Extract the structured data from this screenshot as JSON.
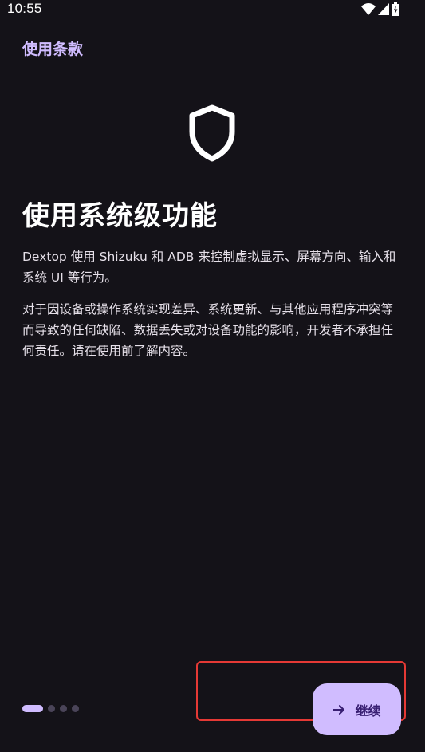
{
  "status_bar": {
    "time": "10:55",
    "icons": [
      "wifi-icon",
      "signal-icon",
      "battery-charging-icon"
    ]
  },
  "app": {
    "title": "使用条款"
  },
  "hero": {
    "icon": "shield-icon"
  },
  "content": {
    "headline": "使用系统级功能",
    "paragraph_1": "Dextop 使用 Shizuku 和 ADB 来控制虚拟显示、屏幕方向、输入和系统 UI 等行为。",
    "paragraph_2": "对于因设备或操作系统实现差异、系统更新、与其他应用程序冲突等而导致的任何缺陷、数据丢失或对设备功能的影响，开发者不承担任何责任。请在使用前了解内容。"
  },
  "pager": {
    "total_pages": 4,
    "current_page": 1
  },
  "actions": {
    "continue_label": "继续",
    "continue_icon": "arrow-right-icon"
  },
  "colors": {
    "background": "#141218",
    "accent": "#D0BCFF",
    "on_accent": "#381E72",
    "highlight": "#E53935"
  }
}
